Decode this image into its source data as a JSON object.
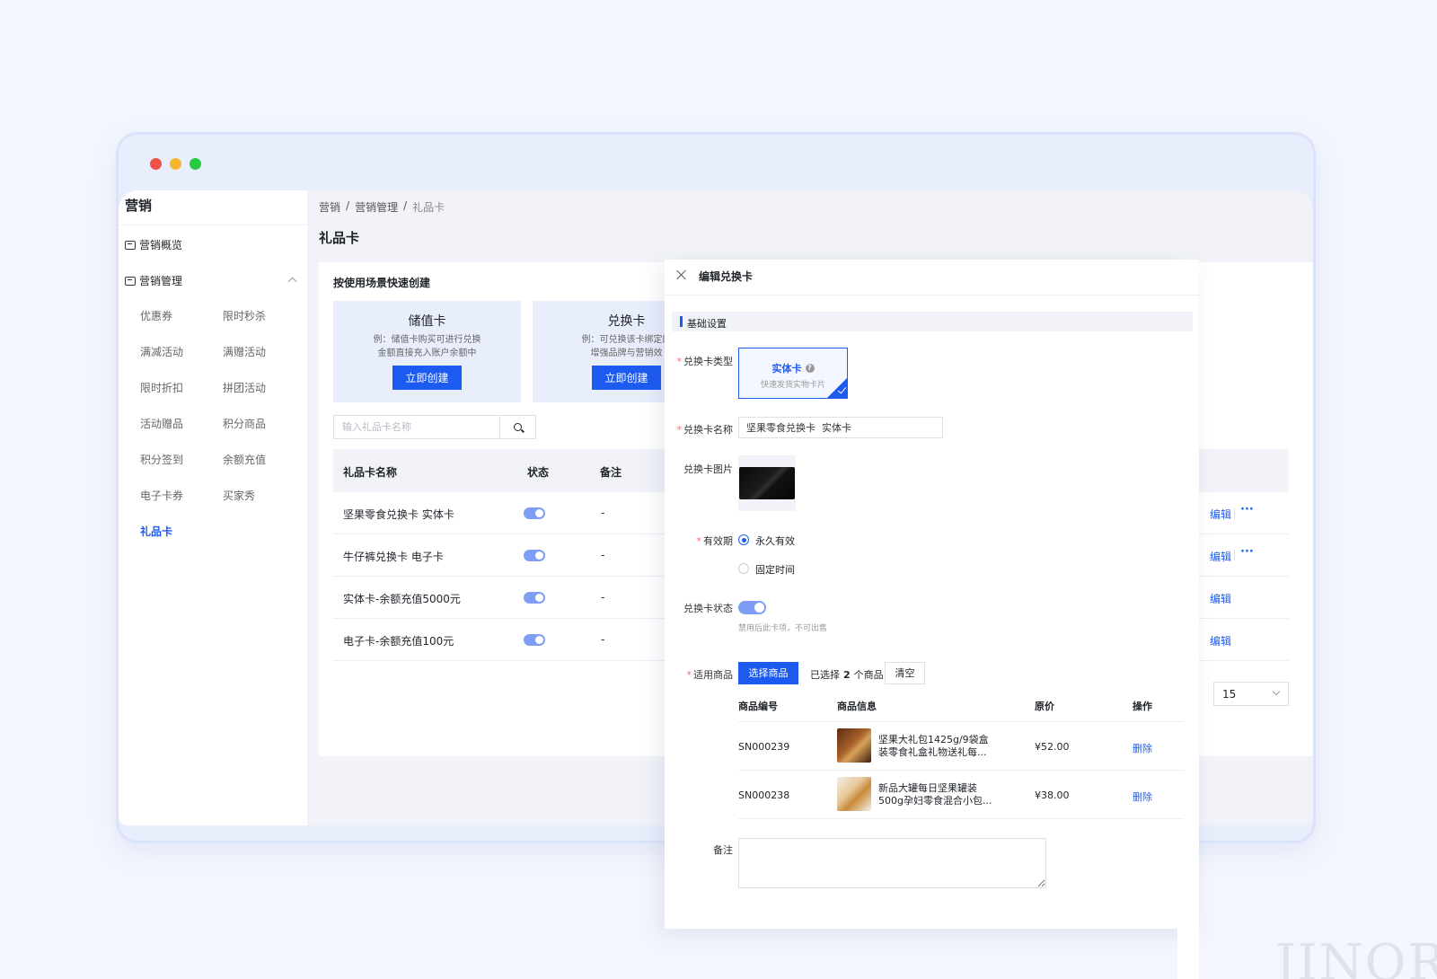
{
  "window_dots": [
    "#f0524b",
    "#f5b531",
    "#27c93f"
  ],
  "sidebar": {
    "module_title": "营销",
    "top_items": [
      {
        "label": "营销概览",
        "icon": "dashboard-icon"
      },
      {
        "label": "营销管理",
        "icon": "marketing-icon"
      }
    ],
    "sub_items": [
      "优惠券",
      "限时秒杀",
      "满减活动",
      "满赠活动",
      "限时折扣",
      "拼团活动",
      "活动赠品",
      "积分商品",
      "积分签到",
      "余额充值",
      "电子卡券",
      "买家秀",
      "礼品卡"
    ],
    "active": "礼品卡"
  },
  "breadcrumb": [
    "营销",
    "营销管理",
    "礼品卡"
  ],
  "page_title": "礼品卡",
  "quick_create": {
    "title": "按使用场景快速创建",
    "cards": [
      {
        "title": "储值卡",
        "desc1": "例：储值卡购买可进行兑换",
        "desc2": "金额直接充入账户余额中",
        "button": "立即创建"
      },
      {
        "title": "兑换卡",
        "desc1": "例：可兑换该卡绑定的",
        "desc2": "增强品牌与营销效",
        "button": "立即创建"
      }
    ]
  },
  "search": {
    "placeholder": "输入礼品卡名称",
    "value": ""
  },
  "table": {
    "headers": [
      "礼品卡名称",
      "状态",
      "备注"
    ],
    "rows": [
      {
        "name": "坚果零食兑换卡 实体卡",
        "status_on": true,
        "note": "-",
        "edit": "编辑",
        "more": "···"
      },
      {
        "name": "牛仔裤兑换卡 电子卡",
        "status_on": true,
        "note": "-",
        "edit": "编辑",
        "more": "···"
      },
      {
        "name": "实体卡-余额充值5000元",
        "status_on": true,
        "note": "-",
        "edit": "编辑",
        "more": ""
      },
      {
        "name": "电子卡-余额充值100元",
        "status_on": true,
        "note": "-",
        "edit": "编辑",
        "more": ""
      }
    ],
    "page_size": "15"
  },
  "drawer": {
    "title": "编辑兑换卡",
    "section": "基础设置",
    "card_type_label": "兑换卡类型",
    "card_type": {
      "title": "实体卡",
      "help": "?",
      "desc": "快速发货实物卡片"
    },
    "name_label": "兑换卡名称",
    "name_value": "坚果零食兑换卡  实体卡",
    "image_label": "兑换卡图片",
    "validity_label": "有效期",
    "validity_options": [
      "永久有效",
      "固定时间"
    ],
    "validity_selected": "永久有效",
    "status_label": "兑换卡状态",
    "status_on": true,
    "status_hint": "禁用后此卡项，不可出售",
    "goods_label": "适用商品",
    "select_goods": "选择商品",
    "selected_prefix": "已选择",
    "selected_count": "2",
    "selected_suffix": "个商品",
    "clear": "清空",
    "goods_headers": [
      "商品编号",
      "商品信息",
      "原价",
      "操作"
    ],
    "goods": [
      {
        "sn": "SN000239",
        "info1": "坚果大礼包1425g/9袋盒",
        "info2": "装零食礼盒礼物送礼每...",
        "price": "¥52.00",
        "action": "删除"
      },
      {
        "sn": "SN000238",
        "info1": "新品大罐每日坚果罐装",
        "info2": "500g孕妇零食混合小包...",
        "price": "¥38.00",
        "action": "删除"
      }
    ],
    "remark_label": "备注",
    "remark_value": ""
  },
  "watermark": "JINOR"
}
